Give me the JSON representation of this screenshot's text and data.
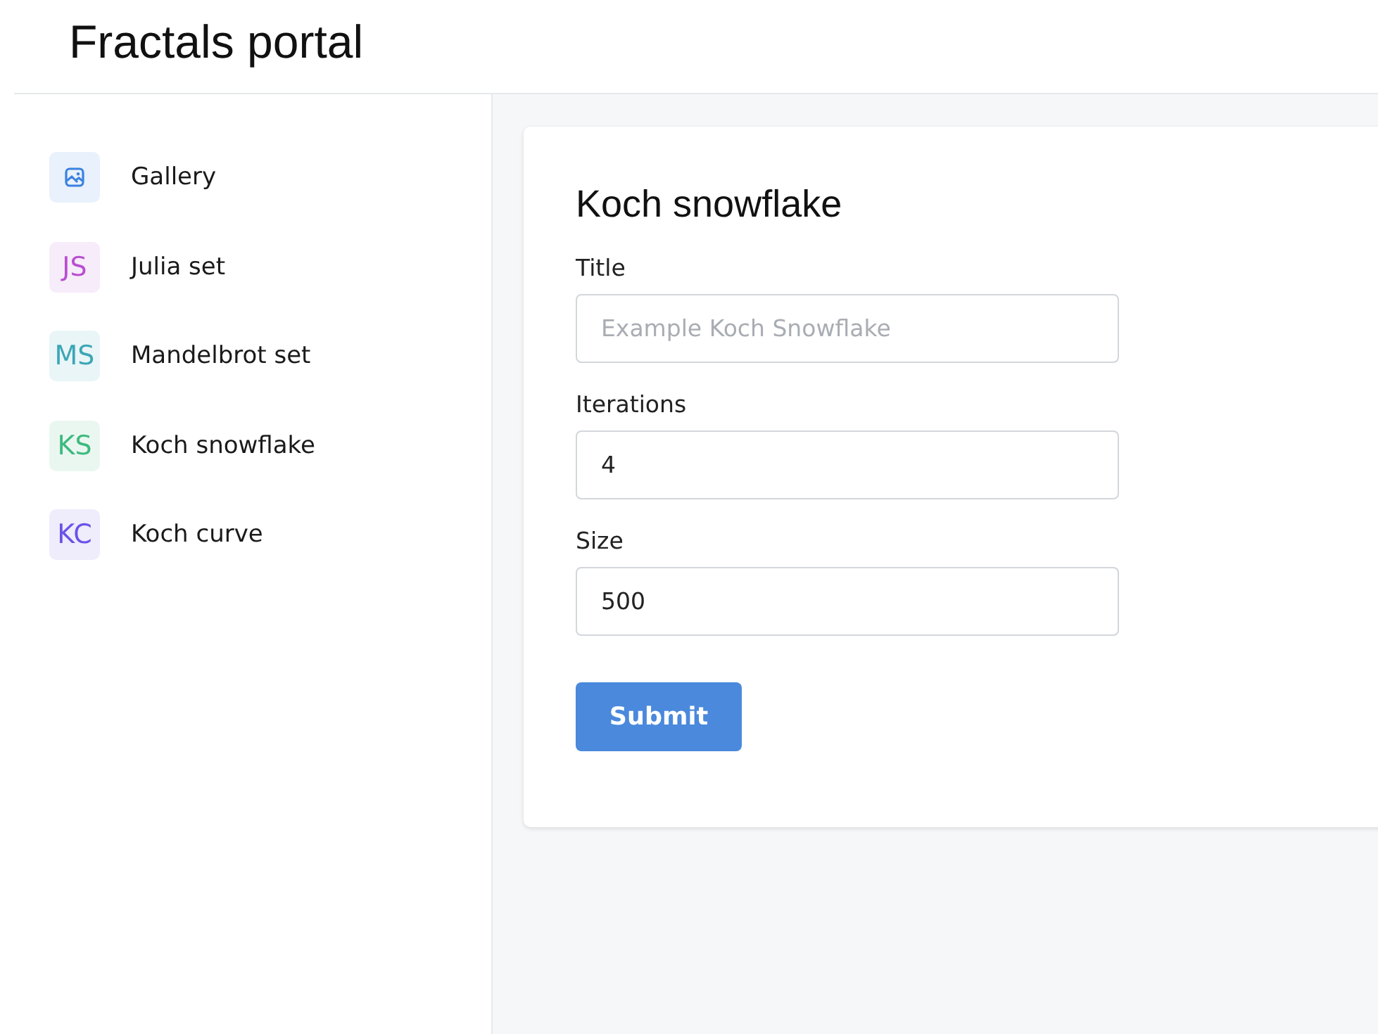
{
  "header": {
    "title": "Fractals portal"
  },
  "sidebar": {
    "items": [
      {
        "kind": "image",
        "label": "Gallery",
        "color": "#3b82e0"
      },
      {
        "kind": "initials",
        "initials": "JS",
        "label": "Julia set",
        "color": "#b84fd0"
      },
      {
        "kind": "initials",
        "initials": "MS",
        "label": "Mandelbrot set",
        "color": "#3ba6b5"
      },
      {
        "kind": "initials",
        "initials": "KS",
        "label": "Koch snowflake",
        "color": "#3dba7e"
      },
      {
        "kind": "initials",
        "initials": "KC",
        "label": "Koch curve",
        "color": "#6b52e8"
      }
    ]
  },
  "form": {
    "title": "Koch snowflake",
    "fields": [
      {
        "label": "Title",
        "placeholder": "Example Koch Snowflake"
      },
      {
        "label": "Iterations",
        "value": "4"
      },
      {
        "label": "Size",
        "value": "500"
      }
    ],
    "submit": "Submit"
  }
}
